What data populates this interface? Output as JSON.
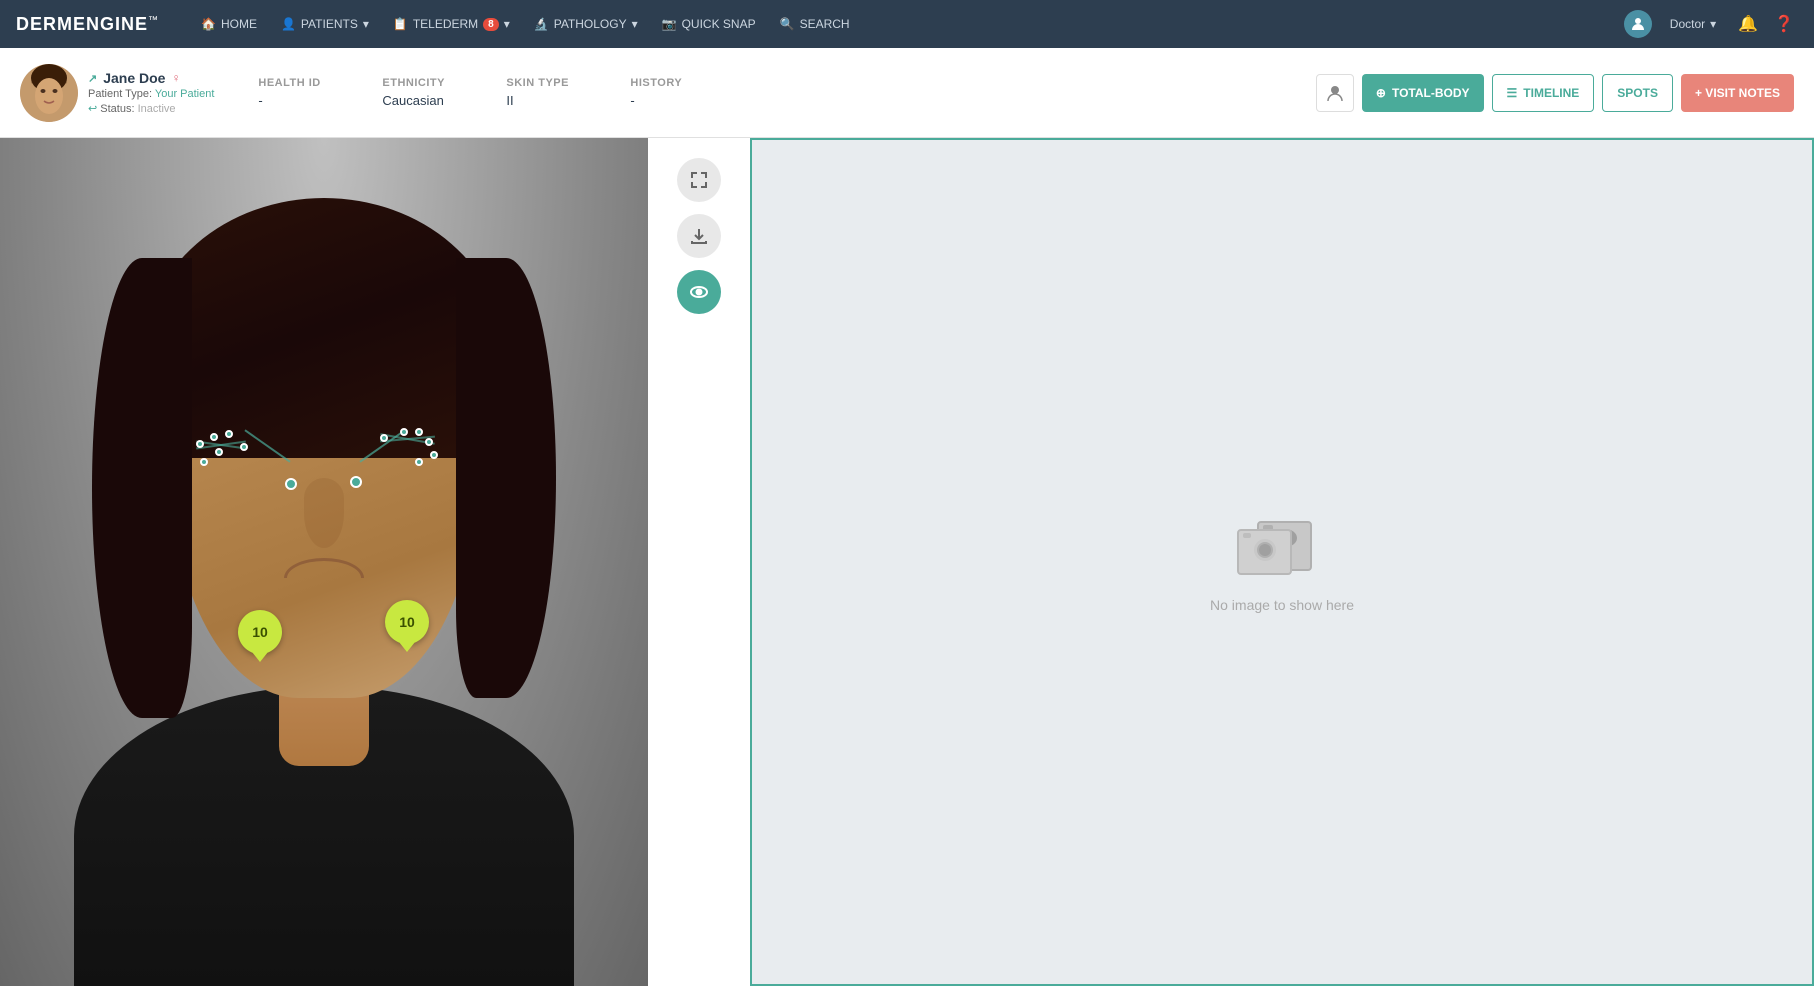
{
  "brand": {
    "name_light": "DERM",
    "name_bold": "ENGINE",
    "trademark": "™"
  },
  "nav": {
    "items": [
      {
        "label": "HOME",
        "icon": "🏠",
        "has_dropdown": false
      },
      {
        "label": "PATIENTS",
        "icon": "👤",
        "has_dropdown": true
      },
      {
        "label": "TELEDERM",
        "icon": "📋",
        "has_dropdown": true,
        "badge": "8"
      },
      {
        "label": "PATHOLOGY",
        "icon": "🔬",
        "has_dropdown": true
      },
      {
        "label": "QUICK SNAP",
        "icon": "📷",
        "has_dropdown": false
      },
      {
        "label": "SEARCH",
        "icon": "🔍",
        "has_dropdown": false
      }
    ],
    "user": "Doctor",
    "user_icon": "👤"
  },
  "patient": {
    "name": "Jane Doe",
    "patient_type_label": "Patient Type:",
    "patient_type_value": "Your Patient",
    "status_label": "Status:",
    "status_value": "Inactive",
    "health_id_label": "Health ID",
    "health_id_value": "-",
    "ethnicity_label": "Ethnicity",
    "ethnicity_value": "Caucasian",
    "skin_type_label": "Skin Type",
    "skin_type_value": "II",
    "history_label": "History",
    "history_value": "-"
  },
  "actions": {
    "total_body": "TOTAL-BODY",
    "timeline": "TIMELINE",
    "spots": "SPOTS",
    "visit_notes": "+ VISIT NOTES"
  },
  "spots": [
    {
      "id": "spot-left",
      "value": "10",
      "x": "218",
      "y": "490"
    },
    {
      "id": "spot-right",
      "value": "10",
      "x": "375",
      "y": "480"
    }
  ],
  "sidebar_icons": [
    {
      "name": "fullscreen-icon",
      "symbol": "⤢",
      "active": false
    },
    {
      "name": "download-icon",
      "symbol": "⬇",
      "active": false
    },
    {
      "name": "eye-icon",
      "symbol": "👁",
      "active": true
    }
  ],
  "right_panel": {
    "no_image_text": "No image to show here"
  }
}
